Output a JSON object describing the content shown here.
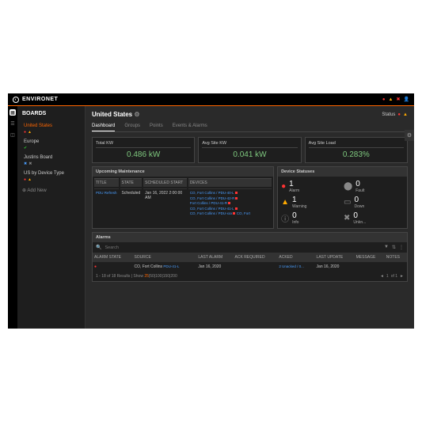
{
  "brand": "ENVIRONET",
  "sidebar": {
    "title": "BOARDS",
    "items": [
      {
        "name": "United States",
        "active": true
      },
      {
        "name": "Europe"
      },
      {
        "name": "Justins Board"
      },
      {
        "name": "US by Device Type"
      }
    ],
    "add": "Add New"
  },
  "page": {
    "title": "United States",
    "status_label": "Status"
  },
  "tabs": [
    "Dashboard",
    "Groups",
    "Points",
    "Events & Alarms"
  ],
  "kpis": [
    {
      "label": "Total KW",
      "value": "0.486 kW"
    },
    {
      "label": "Avg Site KW",
      "value": "0.041 kW"
    },
    {
      "label": "Avg Site Load",
      "value": "0.283%"
    }
  ],
  "maintenance": {
    "title": "Upcoming Maintenance",
    "headers": [
      "TITLE",
      "STATE",
      "SCHEDULED START",
      "DEVICES"
    ],
    "row": {
      "title": "PDU Refresh",
      "state": "Scheduled",
      "start": "Jan 16, 2022 2:00:00 AM",
      "devices": [
        "CO, Fort Collins / PDU-40-L",
        "CO, Fort Collins / PDU-42-R",
        "Fort Collins / PDU-41-R",
        "CO, Fort Collins / PDU-41-L",
        "CO, Fort Collins / PDU-xxx",
        "CO, Fort"
      ]
    }
  },
  "device_statuses": {
    "title": "Device Statuses",
    "items": [
      {
        "icon": "alarm",
        "count": "1",
        "label": "Alarm"
      },
      {
        "icon": "fault",
        "count": "0",
        "label": "Fault"
      },
      {
        "icon": "warning",
        "count": "1",
        "label": "Warning"
      },
      {
        "icon": "down",
        "count": "0",
        "label": "Down"
      },
      {
        "icon": "info",
        "count": "0",
        "label": "Info"
      },
      {
        "icon": "unkn",
        "count": "0",
        "label": "Unkn..."
      }
    ]
  },
  "alarms": {
    "title": "Alarms",
    "search_placeholder": "Search",
    "headers": [
      "ALARM STATE",
      "SOURCE",
      "LAST ALARM",
      "ACK REQUIRED",
      "ACKED",
      "LAST UPDATE",
      "MESSAGE",
      "NOTES"
    ],
    "row": {
      "state": "",
      "source": "CO, Fort Collins",
      "source_link": "PDU-41-L",
      "last_alarm": "Jan 16, 2020",
      "ack_required": "",
      "acked": "2 Unacked / 0...",
      "last_update": "Jan 16, 2020",
      "message": "",
      "notes": ""
    },
    "pager": {
      "text": "1 - 18 of 18 Results | Show",
      "sizes": [
        "25",
        "50",
        "100",
        "150",
        "200"
      ],
      "page": "of 1",
      "current": "1"
    }
  }
}
